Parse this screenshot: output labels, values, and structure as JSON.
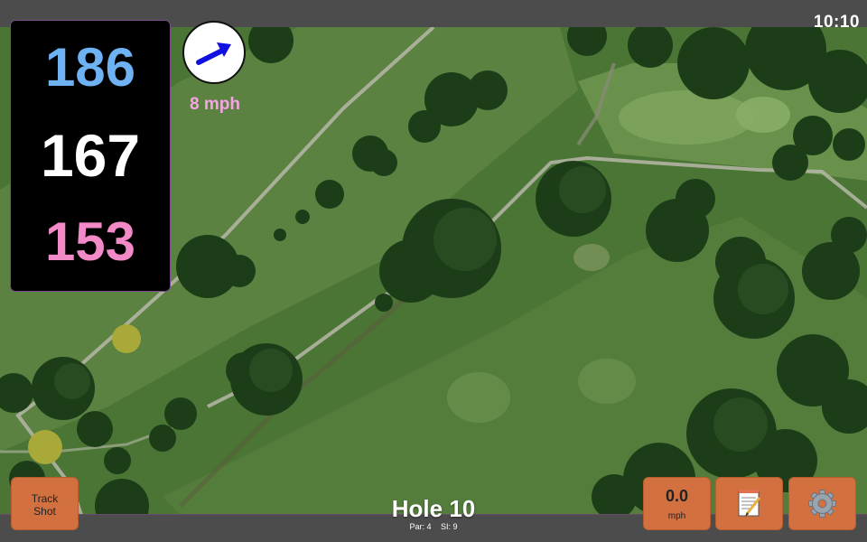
{
  "status": {
    "time": "10:10"
  },
  "distances": {
    "back": "186",
    "middle": "167",
    "front": "153"
  },
  "wind": {
    "speed_label": "8 mph",
    "direction_icon": "wind-arrow-icon"
  },
  "hole": {
    "title": "Hole 10",
    "par": "Par: 4",
    "si": "SI: 9"
  },
  "buttons": {
    "track_shot": {
      "line1": "Track",
      "line2": "Shot"
    },
    "speed": {
      "value": "0.0",
      "unit": "mph"
    },
    "notes_icon": "notepad-icon",
    "settings_icon": "gear-icon"
  },
  "colors": {
    "back": "#6fb2f4",
    "middle": "#ffffff",
    "front": "#f28ac8",
    "wind_text": "#f7a3e6",
    "button_bg": "#d2703f",
    "arrow": "#1010e0"
  }
}
